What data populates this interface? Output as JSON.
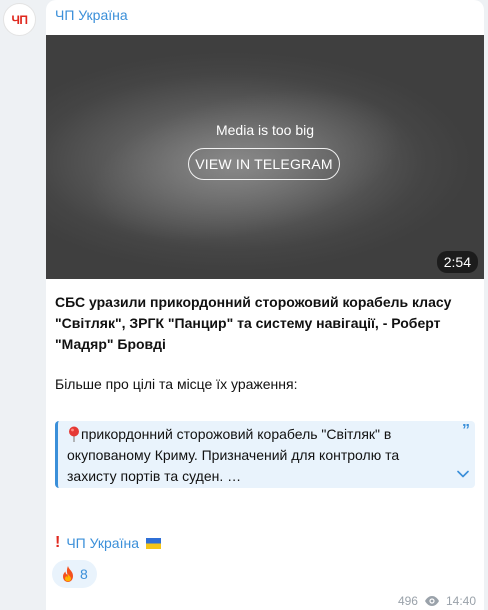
{
  "avatar": {
    "text": "ЧП"
  },
  "channel": {
    "name": "ЧП Україна"
  },
  "media": {
    "message": "Media is too big",
    "button_label": "VIEW IN TELEGRAM",
    "duration": "2:54"
  },
  "post": {
    "headline": "СБС уразили прикордонний сторожовий корабель класу \"Світляк\", ЗРГК \"Панцир\" та систему навігації, - Роберт \"Мадяр\" Бровді",
    "subline": "Більше про цілі та місце їх ураження:"
  },
  "quote": {
    "icon": "round-pushpin-icon",
    "text": "прикордонний сторожовий корабель \"Світляк\" в окупованому Криму. Призначений для контролю та захисту портів та суден. …",
    "mark": "”"
  },
  "signature": {
    "text": "ЧП Україна"
  },
  "reaction": {
    "emoji": "🔥",
    "count": "8"
  },
  "meta": {
    "views": "496",
    "time": "14:40"
  },
  "colors": {
    "accent": "#3a8fd9",
    "brand_red": "#e0281e",
    "quote_bg": "#e9f3fc",
    "muted": "#9aa2aa"
  }
}
